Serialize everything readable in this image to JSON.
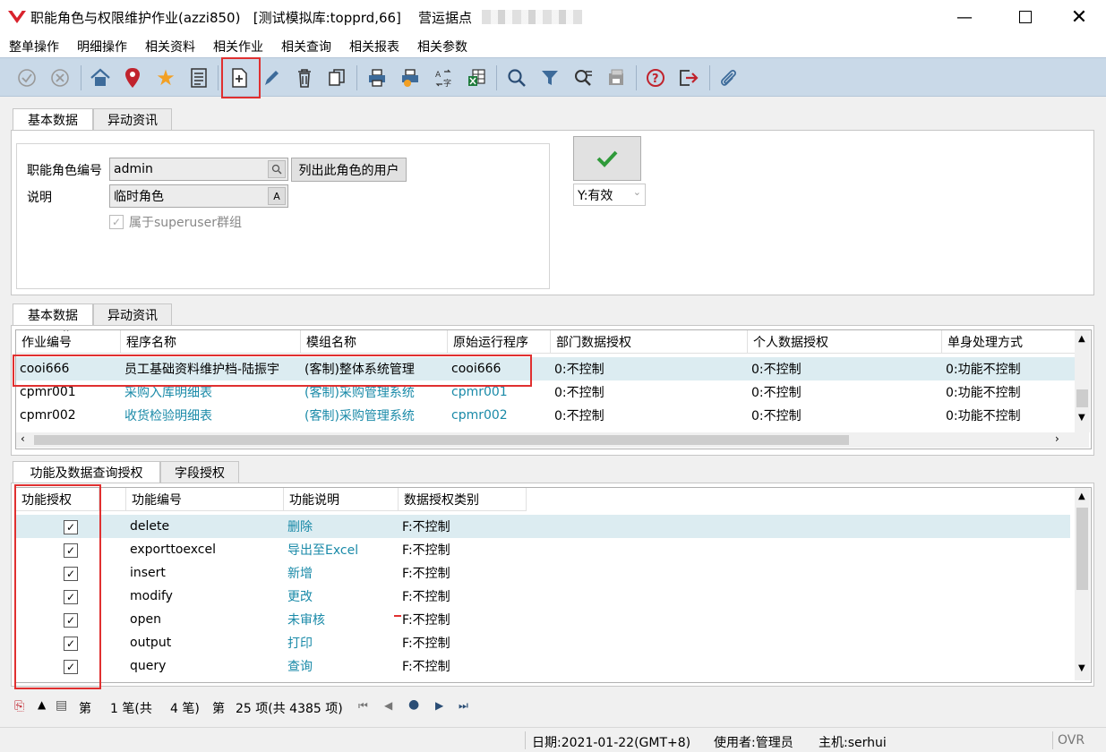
{
  "window": {
    "title": "职能角色与权限维护作业(azzi850)",
    "db": "[测试模拟库:topprd,66]",
    "site": "营运据点"
  },
  "menu": [
    "整单操作",
    "明细操作",
    "相关资料",
    "相关作业",
    "相关查询",
    "相关报表",
    "相关参数"
  ],
  "toolbar": {
    "icons": [
      "check-icon",
      "cancel-icon",
      "home-icon",
      "location-pin-icon",
      "star-icon",
      "list-icon",
      "add-new-icon",
      "edit-pencil-icon",
      "delete-trash-icon",
      "copy-icon",
      "print-icon",
      "print-preview-icon",
      "translate-icon",
      "export-excel-icon",
      "search-icon",
      "filter-icon",
      "query-icon",
      "save-icon",
      "help-icon",
      "exit-icon",
      "attachment-icon"
    ]
  },
  "top_tabs": [
    "基本数据",
    "异动资讯"
  ],
  "form": {
    "role_code_label": "职能角色编号",
    "role_code_value": "admin",
    "list_users_button": "列出此角色的用户",
    "desc_label": "说明",
    "desc_value": "临时角色",
    "superuser_label": "属于superuser群组",
    "status_value": "Y:有效"
  },
  "mid_tabs": [
    "基本数据",
    "异动资讯"
  ],
  "prog_grid": {
    "headers": [
      "作业编号",
      "程序名称",
      "模组名称",
      "原始运行程序",
      "部门数据授权",
      "个人数据授权",
      "单身处理方式"
    ],
    "rows": [
      [
        "cooi666",
        "员工基础资料维护档-陆振宇",
        "(客制)整体系统管理",
        "cooi666",
        "0:不控制",
        "0:不控制",
        "0:功能不控制"
      ],
      [
        "cpmr001",
        "采购入库明细表",
        "(客制)采购管理系统",
        "cpmr001",
        "0:不控制",
        "0:不控制",
        "0:功能不控制"
      ],
      [
        "cpmr002",
        "收货检验明细表",
        "(客制)采购管理系统",
        "cpmr002",
        "0:不控制",
        "0:不控制",
        "0:功能不控制"
      ]
    ]
  },
  "bottom_tabs": [
    "功能及数据查询授权",
    "字段授权"
  ],
  "func_grid": {
    "headers": [
      "功能授权",
      "功能编号",
      "功能说明",
      "数据授权类别"
    ],
    "rows": [
      {
        "id": "delete",
        "desc": "删除",
        "type": "F:不控制"
      },
      {
        "id": "exporttoexcel",
        "desc": "导出至Excel",
        "type": "F:不控制"
      },
      {
        "id": "insert",
        "desc": "新增",
        "type": "F:不控制"
      },
      {
        "id": "modify",
        "desc": "更改",
        "type": "F:不控制"
      },
      {
        "id": "open",
        "desc": "未审核",
        "type": "F:不控制"
      },
      {
        "id": "output",
        "desc": "打印",
        "type": "F:不控制"
      },
      {
        "id": "query",
        "desc": "查询",
        "type": "F:不控制"
      }
    ]
  },
  "pager": {
    "di": "第",
    "record": "1 笔(共",
    "total": "4 笔)",
    "di2": "第",
    "item": "25 项(共 4385 项)"
  },
  "statusbar": {
    "date": "日期:2021-01-22(GMT+8)",
    "user": "使用者:管理员",
    "host": "主机:serhui",
    "mode": "OVR"
  }
}
